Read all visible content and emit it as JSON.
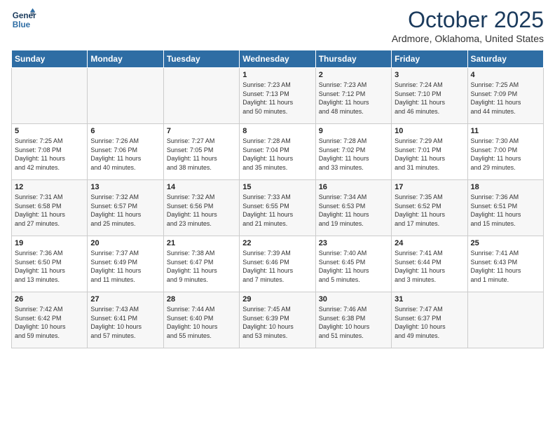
{
  "logo": {
    "line1": "General",
    "line2": "Blue"
  },
  "header": {
    "month": "October 2025",
    "location": "Ardmore, Oklahoma, United States"
  },
  "weekdays": [
    "Sunday",
    "Monday",
    "Tuesday",
    "Wednesday",
    "Thursday",
    "Friday",
    "Saturday"
  ],
  "weeks": [
    [
      {
        "day": "",
        "info": ""
      },
      {
        "day": "",
        "info": ""
      },
      {
        "day": "",
        "info": ""
      },
      {
        "day": "1",
        "info": "Sunrise: 7:23 AM\nSunset: 7:13 PM\nDaylight: 11 hours\nand 50 minutes."
      },
      {
        "day": "2",
        "info": "Sunrise: 7:23 AM\nSunset: 7:12 PM\nDaylight: 11 hours\nand 48 minutes."
      },
      {
        "day": "3",
        "info": "Sunrise: 7:24 AM\nSunset: 7:10 PM\nDaylight: 11 hours\nand 46 minutes."
      },
      {
        "day": "4",
        "info": "Sunrise: 7:25 AM\nSunset: 7:09 PM\nDaylight: 11 hours\nand 44 minutes."
      }
    ],
    [
      {
        "day": "5",
        "info": "Sunrise: 7:25 AM\nSunset: 7:08 PM\nDaylight: 11 hours\nand 42 minutes."
      },
      {
        "day": "6",
        "info": "Sunrise: 7:26 AM\nSunset: 7:06 PM\nDaylight: 11 hours\nand 40 minutes."
      },
      {
        "day": "7",
        "info": "Sunrise: 7:27 AM\nSunset: 7:05 PM\nDaylight: 11 hours\nand 38 minutes."
      },
      {
        "day": "8",
        "info": "Sunrise: 7:28 AM\nSunset: 7:04 PM\nDaylight: 11 hours\nand 35 minutes."
      },
      {
        "day": "9",
        "info": "Sunrise: 7:28 AM\nSunset: 7:02 PM\nDaylight: 11 hours\nand 33 minutes."
      },
      {
        "day": "10",
        "info": "Sunrise: 7:29 AM\nSunset: 7:01 PM\nDaylight: 11 hours\nand 31 minutes."
      },
      {
        "day": "11",
        "info": "Sunrise: 7:30 AM\nSunset: 7:00 PM\nDaylight: 11 hours\nand 29 minutes."
      }
    ],
    [
      {
        "day": "12",
        "info": "Sunrise: 7:31 AM\nSunset: 6:58 PM\nDaylight: 11 hours\nand 27 minutes."
      },
      {
        "day": "13",
        "info": "Sunrise: 7:32 AM\nSunset: 6:57 PM\nDaylight: 11 hours\nand 25 minutes."
      },
      {
        "day": "14",
        "info": "Sunrise: 7:32 AM\nSunset: 6:56 PM\nDaylight: 11 hours\nand 23 minutes."
      },
      {
        "day": "15",
        "info": "Sunrise: 7:33 AM\nSunset: 6:55 PM\nDaylight: 11 hours\nand 21 minutes."
      },
      {
        "day": "16",
        "info": "Sunrise: 7:34 AM\nSunset: 6:53 PM\nDaylight: 11 hours\nand 19 minutes."
      },
      {
        "day": "17",
        "info": "Sunrise: 7:35 AM\nSunset: 6:52 PM\nDaylight: 11 hours\nand 17 minutes."
      },
      {
        "day": "18",
        "info": "Sunrise: 7:36 AM\nSunset: 6:51 PM\nDaylight: 11 hours\nand 15 minutes."
      }
    ],
    [
      {
        "day": "19",
        "info": "Sunrise: 7:36 AM\nSunset: 6:50 PM\nDaylight: 11 hours\nand 13 minutes."
      },
      {
        "day": "20",
        "info": "Sunrise: 7:37 AM\nSunset: 6:49 PM\nDaylight: 11 hours\nand 11 minutes."
      },
      {
        "day": "21",
        "info": "Sunrise: 7:38 AM\nSunset: 6:47 PM\nDaylight: 11 hours\nand 9 minutes."
      },
      {
        "day": "22",
        "info": "Sunrise: 7:39 AM\nSunset: 6:46 PM\nDaylight: 11 hours\nand 7 minutes."
      },
      {
        "day": "23",
        "info": "Sunrise: 7:40 AM\nSunset: 6:45 PM\nDaylight: 11 hours\nand 5 minutes."
      },
      {
        "day": "24",
        "info": "Sunrise: 7:41 AM\nSunset: 6:44 PM\nDaylight: 11 hours\nand 3 minutes."
      },
      {
        "day": "25",
        "info": "Sunrise: 7:41 AM\nSunset: 6:43 PM\nDaylight: 11 hours\nand 1 minute."
      }
    ],
    [
      {
        "day": "26",
        "info": "Sunrise: 7:42 AM\nSunset: 6:42 PM\nDaylight: 10 hours\nand 59 minutes."
      },
      {
        "day": "27",
        "info": "Sunrise: 7:43 AM\nSunset: 6:41 PM\nDaylight: 10 hours\nand 57 minutes."
      },
      {
        "day": "28",
        "info": "Sunrise: 7:44 AM\nSunset: 6:40 PM\nDaylight: 10 hours\nand 55 minutes."
      },
      {
        "day": "29",
        "info": "Sunrise: 7:45 AM\nSunset: 6:39 PM\nDaylight: 10 hours\nand 53 minutes."
      },
      {
        "day": "30",
        "info": "Sunrise: 7:46 AM\nSunset: 6:38 PM\nDaylight: 10 hours\nand 51 minutes."
      },
      {
        "day": "31",
        "info": "Sunrise: 7:47 AM\nSunset: 6:37 PM\nDaylight: 10 hours\nand 49 minutes."
      },
      {
        "day": "",
        "info": ""
      }
    ]
  ]
}
